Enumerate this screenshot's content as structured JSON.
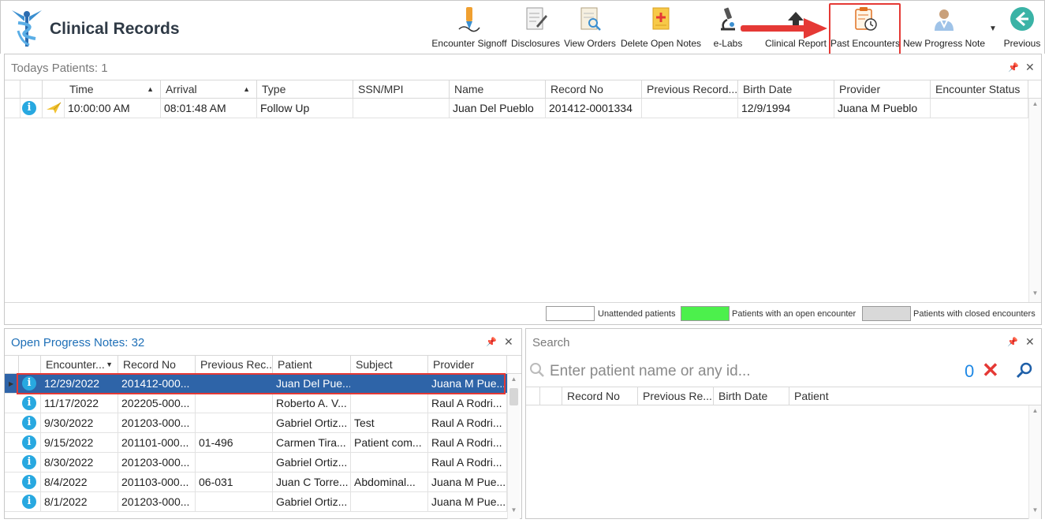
{
  "app": {
    "title": "Clinical Records"
  },
  "toolbar": [
    {
      "id": "encounter-signoff",
      "label": "Encounter Signoff",
      "icon": "pen-signoff-icon"
    },
    {
      "id": "disclosures",
      "label": "Disclosures",
      "icon": "document-pen-icon"
    },
    {
      "id": "view-orders",
      "label": "View Orders",
      "icon": "document-search-icon"
    },
    {
      "id": "delete-open-notes",
      "label": "Delete Open Notes",
      "icon": "note-delete-icon"
    },
    {
      "id": "e-labs",
      "label": "e-Labs",
      "icon": "microscope-icon"
    },
    {
      "id": "clinical-report",
      "label": "Clinical Report",
      "icon": "upload-report-icon"
    },
    {
      "id": "past-encounters",
      "label": "Past Encounters",
      "icon": "clipboard-clock-icon"
    },
    {
      "id": "new-progress-note",
      "label": "New Progress Note",
      "icon": "doctor-icon"
    },
    {
      "id": "previous",
      "label": "Previous",
      "icon": "back-arrow-icon"
    }
  ],
  "todays_patients": {
    "title": "Todays Patients:",
    "count": "1",
    "columns": [
      "Time",
      "Arrival",
      "Type",
      "SSN/MPI",
      "Name",
      "Record No",
      "Previous Record...",
      "Birth Date",
      "Provider",
      "Encounter Status"
    ],
    "rows": [
      {
        "time": "10:00:00 AM",
        "arrival": "08:01:48 AM",
        "type": "Follow Up",
        "ssn": "",
        "name": "Juan Del Pueblo",
        "record_no": "201412-0001334",
        "prev_record": "",
        "birth_date": "12/9/1994",
        "provider": "Juana M Pueblo",
        "status": ""
      }
    ]
  },
  "legend": {
    "unattended": "Unattended patients",
    "open": "Patients with an open encounter",
    "closed": "Patients with closed encounters",
    "colors": {
      "unattended": "#ffffff",
      "open": "#4cf04c",
      "closed": "#d9d9d9"
    }
  },
  "open_notes": {
    "title": "Open Progress Notes:",
    "count": "32",
    "columns": [
      "Encounter...",
      "Record No",
      "Previous Rec...",
      "Patient",
      "Subject",
      "Provider"
    ],
    "rows": [
      {
        "date": "12/29/2022",
        "record": "201412-000...",
        "prev": "",
        "patient": "Juan Del Pue...",
        "subject": "",
        "provider": "Juana M Pue..."
      },
      {
        "date": "11/17/2022",
        "record": "202205-000...",
        "prev": "",
        "patient": "Roberto A. V...",
        "subject": "",
        "provider": "Raul A Rodri..."
      },
      {
        "date": "9/30/2022",
        "record": "201203-000...",
        "prev": "",
        "patient": "Gabriel Ortiz...",
        "subject": "Test",
        "provider": "Raul A Rodri..."
      },
      {
        "date": "9/15/2022",
        "record": "201101-000...",
        "prev": "01-496",
        "patient": "Carmen Tira...",
        "subject": "Patient com...",
        "provider": "Raul A Rodri..."
      },
      {
        "date": "8/30/2022",
        "record": "201203-000...",
        "prev": "",
        "patient": "Gabriel Ortiz...",
        "subject": "",
        "provider": "Raul A Rodri..."
      },
      {
        "date": "8/4/2022",
        "record": "201103-000...",
        "prev": "06-031",
        "patient": "Juan C Torre...",
        "subject": "Abdominal...",
        "provider": "Juana M Pue..."
      },
      {
        "date": "8/1/2022",
        "record": "201203-000...",
        "prev": "",
        "patient": "Gabriel Ortiz...",
        "subject": "",
        "provider": "Juana M Pue..."
      }
    ]
  },
  "search": {
    "title": "Search",
    "placeholder": "Enter patient name or any id...",
    "count": "0",
    "columns": [
      "Record No",
      "Previous Re...",
      "Birth Date",
      "Patient"
    ]
  }
}
